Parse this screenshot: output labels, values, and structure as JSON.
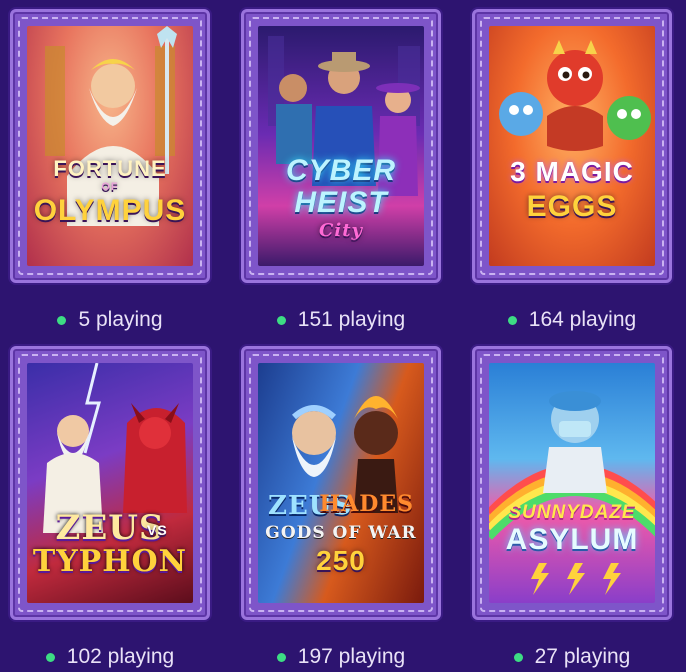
{
  "games": [
    {
      "title": "FORTUNE OF OLYMPUS",
      "logo_line1": "FORTUNE",
      "logo_line2": "OLYMPUS",
      "logo_small": "OF",
      "players": "5 playing"
    },
    {
      "title": "CYBER HEIST City",
      "logo_line1": "CYBER",
      "logo_line2": "HEIST",
      "logo_small": "City",
      "players": "151 playing"
    },
    {
      "title": "3 MAGIC EGGS",
      "logo_line1": "3 MAGIC",
      "logo_line2": "EGGS",
      "logo_small": "",
      "players": "164 playing"
    },
    {
      "title": "ZEUS VS TYPHON",
      "logo_line1": "ZEUS",
      "logo_line2": "TYPHON",
      "logo_small": "VS",
      "players": "102 playing"
    },
    {
      "title": "ZEUS VS HADES GODS OF WAR 250",
      "logo_line1": "ZEUS",
      "logo_line2": "GODS OF WAR",
      "logo_small": "HADES",
      "logo_number": "250",
      "players": "197 playing"
    },
    {
      "title": "SUNNY DAZE ASYLUM",
      "logo_line1": "SUNNYDAZE",
      "logo_line2": "ASYLUM",
      "logo_small": "",
      "players": "27 playing"
    }
  ],
  "colors": {
    "background": "#2d1470",
    "frame": "#7e55c9",
    "status_dot": "#3ddc84",
    "text": "#e9e2f7"
  }
}
